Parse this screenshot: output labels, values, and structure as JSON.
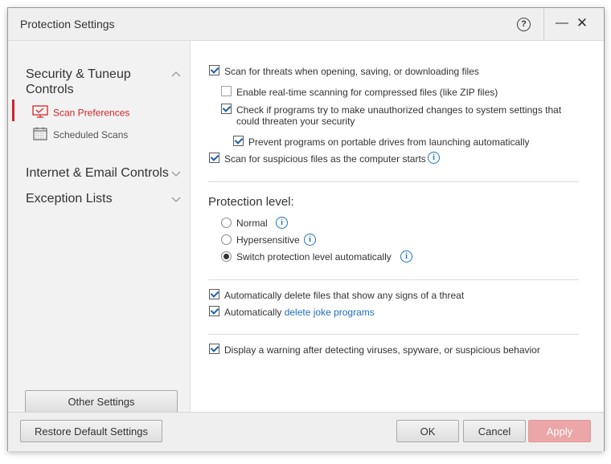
{
  "window": {
    "title": "Protection Settings"
  },
  "titlebar": {
    "help": "?",
    "minimize": "—",
    "close": "✕"
  },
  "sidebar": {
    "groups": [
      {
        "label": "Security & Tuneup\nControls",
        "expanded": true,
        "chevron": "^"
      },
      {
        "label": "Internet & Email Controls",
        "expanded": false,
        "chevron": "˅"
      },
      {
        "label": "Exception Lists",
        "expanded": false,
        "chevron": "˅"
      }
    ],
    "items": [
      {
        "label": "Scan Preferences",
        "icon": "monitor-icon",
        "active": true
      },
      {
        "label": "Scheduled Scans",
        "icon": "calendar-icon",
        "active": false
      }
    ],
    "other_settings": "Other Settings"
  },
  "scan": {
    "open_save_download": {
      "label": "Scan for threats when opening, saving, or downloading files",
      "checked": true
    },
    "compressed": {
      "label": "Enable real-time scanning for compressed files (like ZIP files)",
      "checked": false
    },
    "unauthorized_changes": {
      "label": "Check if programs try to make unauthorized changes to system settings that could threaten your security",
      "checked": true
    },
    "portable_drives": {
      "label": "Prevent programs on portable drives from launching automatically",
      "checked": true
    },
    "startup": {
      "label": "Scan for suspicious files as the computer starts",
      "checked": true
    }
  },
  "protection_level": {
    "title": "Protection level:",
    "options": [
      {
        "label": "Normal",
        "selected": false
      },
      {
        "label": "Hypersensitive",
        "selected": false
      },
      {
        "label": "Switch protection level automatically",
        "selected": true
      }
    ]
  },
  "delete": {
    "threats": {
      "label": "Automatically delete files that show any signs of a threat",
      "checked": true
    },
    "joke_prefix": "Automatically ",
    "joke_link": "delete joke programs",
    "joke_checked": true
  },
  "warning": {
    "label": "Display a warning after detecting viruses, spyware, or suspicious behavior",
    "checked": true
  },
  "footer": {
    "restore": "Restore Default Settings",
    "ok": "OK",
    "cancel": "Cancel",
    "apply": "Apply"
  },
  "colors": {
    "accent": "#d2232a",
    "link": "#1b6fbf",
    "info": "#1b74c4",
    "apply_disabled": "#eba6a7"
  }
}
